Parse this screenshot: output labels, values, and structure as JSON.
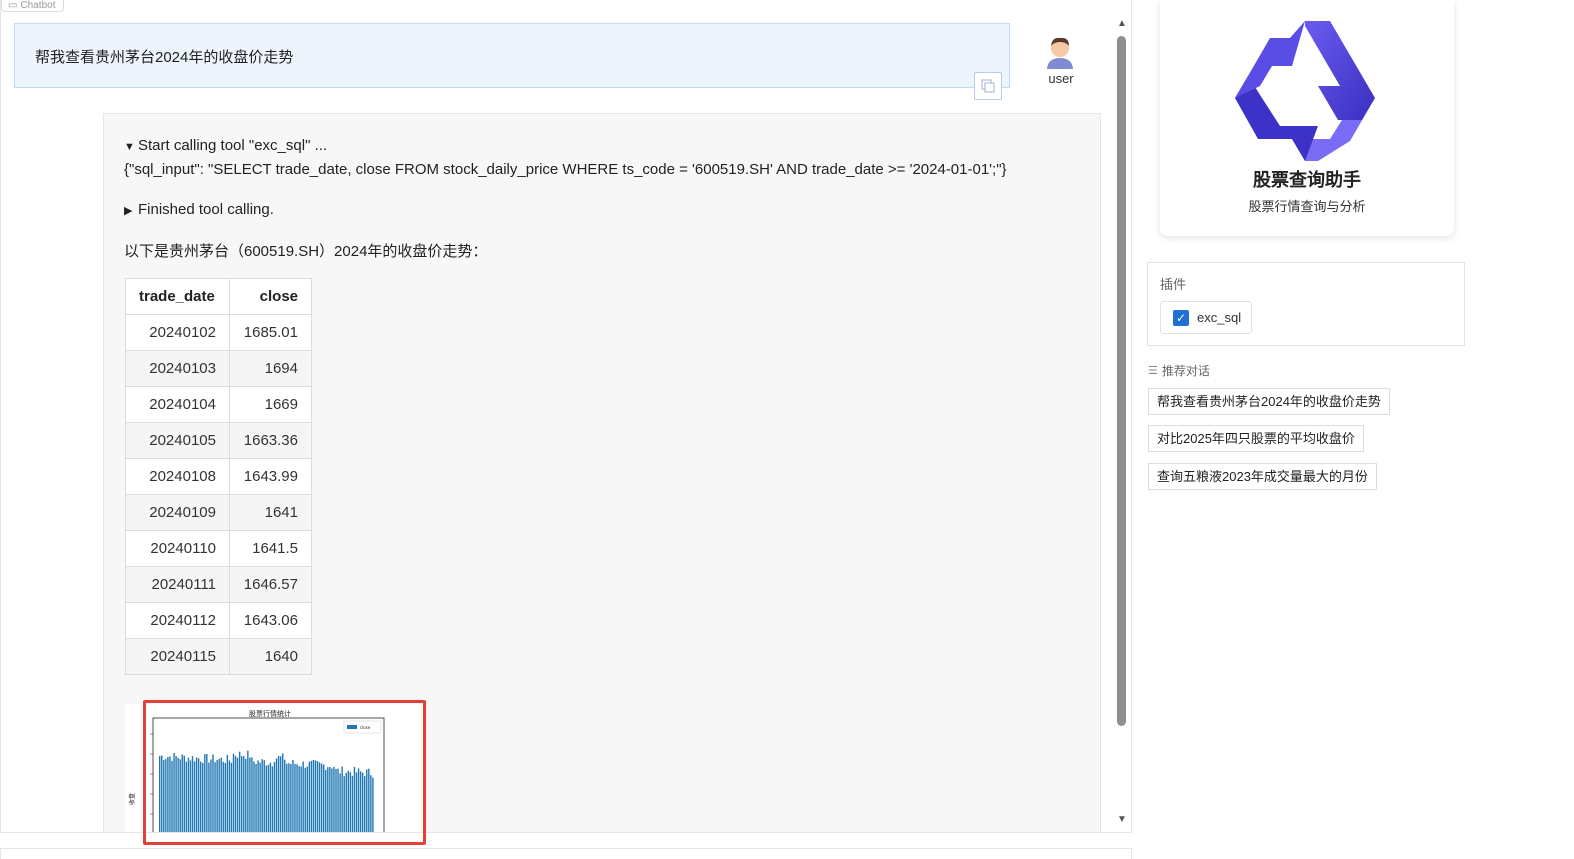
{
  "chatbot": {
    "tab_label": "Chatbot",
    "user_message": "帮我查看贵州茅台2024年的收盘价走势",
    "user_label": "user",
    "tool_start": "Start calling tool \"exc_sql\" ...",
    "tool_input": "{\"sql_input\": \"SELECT trade_date, close FROM stock_daily_price WHERE ts_code = '600519.SH' AND trade_date >= '2024-01-01';\"}",
    "tool_finished": "Finished tool calling.",
    "intro_text": "以下是贵州茅台（600519.SH）2024年的收盘价走势：",
    "table": {
      "headers": [
        "trade_date",
        "close"
      ],
      "rows": [
        [
          "20240102",
          "1685.01"
        ],
        [
          "20240103",
          "1694"
        ],
        [
          "20240104",
          "1669"
        ],
        [
          "20240105",
          "1663.36"
        ],
        [
          "20240108",
          "1643.99"
        ],
        [
          "20240109",
          "1641"
        ],
        [
          "20240110",
          "1641.5"
        ],
        [
          "20240111",
          "1646.57"
        ],
        [
          "20240112",
          "1643.06"
        ],
        [
          "20240115",
          "1640"
        ]
      ]
    },
    "chart_image": {
      "title": "股票行情统计",
      "legend": "close",
      "ylabel": "收盘"
    }
  },
  "sidebar": {
    "agent_name": "股票查询助手",
    "agent_description": "股票行情查询与分析",
    "plugins_title": "插件",
    "plugin_name": "exc_sql",
    "plugin_checked": true,
    "suggestions_title": "推荐对话",
    "suggestions": [
      "帮我查看贵州茅台2024年的收盘价走势",
      "对比2025年四只股票的平均收盘价",
      "查询五粮液2023年成交量最大的月份"
    ]
  },
  "colors": {
    "accent": "#1f6fd6",
    "user_bubble": "#eef4fc",
    "highlight_box": "#e0413b",
    "logo_primary": "#4b3fd8",
    "bar_color": "#1f77b4"
  }
}
